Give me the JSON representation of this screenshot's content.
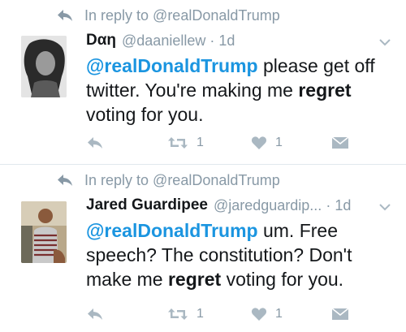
{
  "tweets": [
    {
      "reply_context": "In reply to @realDonaldTrump",
      "name": "Dαη",
      "handle": "@daaniellew",
      "separator": "·",
      "time": "1d",
      "segments": [
        {
          "text": "@realDonaldTrump",
          "style": "mention"
        },
        {
          "text": " please get off twitter. You're making me ",
          "style": "plain"
        },
        {
          "text": "regret",
          "style": "strong"
        },
        {
          "text": " voting for you.",
          "style": "plain"
        }
      ],
      "retweet_count": "1",
      "like_count": "1"
    },
    {
      "reply_context": "In reply to @realDonaldTrump",
      "name": "Jared Guardipee",
      "handle": "@jaredguardip...",
      "separator": "·",
      "time": "1d",
      "segments": [
        {
          "text": "@realDonaldTrump",
          "style": "mention"
        },
        {
          "text": " um. Free speech? The constitution? Don't make me ",
          "style": "plain"
        },
        {
          "text": "regret",
          "style": "strong"
        },
        {
          "text": " voting for you.",
          "style": "plain"
        }
      ],
      "retweet_count": "1",
      "like_count": "1"
    }
  ],
  "colors": {
    "mention": "#1b95e0",
    "meta": "#8899a6",
    "icon": "#aab8c2",
    "text": "#14171a",
    "divider": "#e1e8ed"
  },
  "icons": {
    "reply": "reply-arrow-icon",
    "retweet": "retweet-icon",
    "like": "heart-icon",
    "dm": "envelope-icon",
    "caret": "chevron-down-icon"
  }
}
